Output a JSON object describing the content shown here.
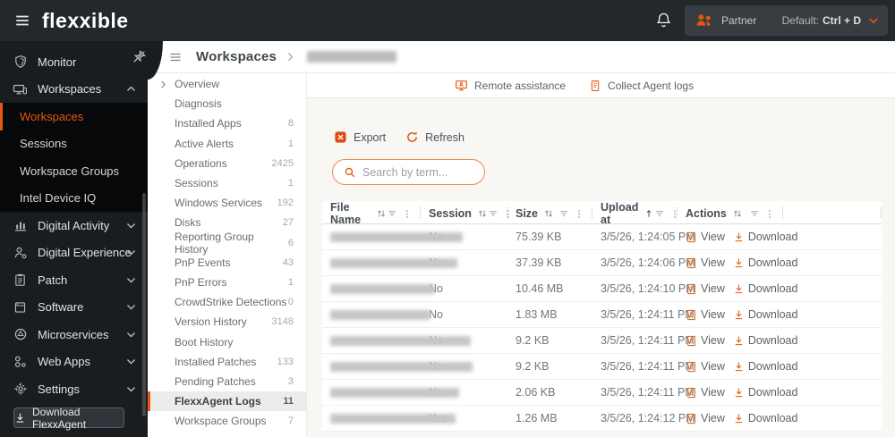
{
  "topbar": {
    "logo": "flexxible",
    "partner_label": "Partner",
    "default_label": "Default:",
    "default_shortcut": "Ctrl + D"
  },
  "sidebar": {
    "items": [
      {
        "label": "Monitor",
        "icon": "shield-icon",
        "chevron": null
      },
      {
        "label": "Workspaces",
        "icon": "workspaces-icon",
        "chevron": "up",
        "expanded": true
      },
      {
        "label": "Digital Activity",
        "icon": "bar-chart-icon",
        "chevron": "down"
      },
      {
        "label": "Digital Experience",
        "icon": "person-gear-icon",
        "chevron": "down"
      },
      {
        "label": "Patch",
        "icon": "clipboard-icon",
        "chevron": "down"
      },
      {
        "label": "Software",
        "icon": "package-icon",
        "chevron": "down"
      },
      {
        "label": "Microservices",
        "icon": "globe-icon",
        "chevron": "down"
      },
      {
        "label": "Web Apps",
        "icon": "nodes-icon",
        "chevron": "down"
      },
      {
        "label": "Settings",
        "icon": "gear-icon",
        "chevron": "down"
      }
    ],
    "workspaces_submenu": [
      {
        "label": "Workspaces",
        "selected": true
      },
      {
        "label": "Sessions",
        "selected": false
      },
      {
        "label": "Workspace Groups",
        "selected": false
      },
      {
        "label": "Intel Device IQ",
        "selected": false
      }
    ],
    "download_button": "Download FlexxAgent"
  },
  "breadcrumb": {
    "root": "Workspaces",
    "item_redacted": true
  },
  "secondary_nav": {
    "items": [
      {
        "label": "Overview",
        "count": "",
        "expandable": true
      },
      {
        "label": "Diagnosis",
        "count": ""
      },
      {
        "label": "Installed Apps",
        "count": "8"
      },
      {
        "label": "Active Alerts",
        "count": "1"
      },
      {
        "label": "Operations",
        "count": "2425"
      },
      {
        "label": "Sessions",
        "count": "1"
      },
      {
        "label": "Windows Services",
        "count": "192"
      },
      {
        "label": "Disks",
        "count": "27"
      },
      {
        "label": "Reporting Group History",
        "count": "6"
      },
      {
        "label": "PnP Events",
        "count": "43"
      },
      {
        "label": "PnP Errors",
        "count": "1"
      },
      {
        "label": "CrowdStrike Detections",
        "count": "0"
      },
      {
        "label": "Version History",
        "count": "3148"
      },
      {
        "label": "Boot History",
        "count": ""
      },
      {
        "label": "Installed Patches",
        "count": "133"
      },
      {
        "label": "Pending Patches",
        "count": "3"
      },
      {
        "label": "FlexxAgent Logs",
        "count": "11",
        "selected": true
      },
      {
        "label": "Workspace Groups",
        "count": "7"
      }
    ]
  },
  "page_actions": {
    "remote_assistance": "Remote assistance",
    "collect_agent_logs": "Collect Agent logs"
  },
  "toolbar": {
    "export": "Export",
    "refresh": "Refresh",
    "search_placeholder": "Search by term..."
  },
  "table": {
    "columns": [
      {
        "label": "File Name",
        "sort": "both"
      },
      {
        "label": "Session",
        "sort": "both"
      },
      {
        "label": "Size",
        "sort": "both"
      },
      {
        "label": "Upload at",
        "sort": "asc"
      },
      {
        "label": "Actions",
        "sort": "both"
      }
    ],
    "actions": {
      "view": "View",
      "download": "Download"
    },
    "rows": [
      {
        "file_redacted": true,
        "session": "No",
        "size": "75.39 KB",
        "upload_at": "3/5/26, 1:24:05 PM"
      },
      {
        "file_redacted": true,
        "session": "No",
        "size": "37.39 KB",
        "upload_at": "3/5/26, 1:24:06 PM"
      },
      {
        "file_redacted": true,
        "session": "No",
        "size": "10.46 MB",
        "upload_at": "3/5/26, 1:24:10 PM"
      },
      {
        "file_redacted": true,
        "session": "No",
        "size": "1.83 MB",
        "upload_at": "3/5/26, 1:24:11 PM"
      },
      {
        "file_redacted": true,
        "session": "No",
        "size": "9.2 KB",
        "upload_at": "3/5/26, 1:24:11 PM"
      },
      {
        "file_redacted": true,
        "session": "No",
        "size": "9.2 KB",
        "upload_at": "3/5/26, 1:24:11 PM"
      },
      {
        "file_redacted": true,
        "session": "No",
        "size": "2.06 KB",
        "upload_at": "3/5/26, 1:24:11 PM"
      },
      {
        "file_redacted": true,
        "session": "Yes",
        "size": "1.26 MB",
        "upload_at": "3/5/26, 1:24:12 PM"
      }
    ],
    "redaction_widths": [
      148,
      142,
      117,
      112,
      157,
      159,
      144,
      140
    ],
    "breadcrumb_redaction_width": 100
  },
  "colors": {
    "accent": "#e4570f",
    "accent_light": "#ef8b4b",
    "topbar_bg": "#24282b",
    "sidebar_bg": "#1a1d20",
    "submenu_bg": "#070809",
    "content_bg": "#f8f7f4"
  }
}
